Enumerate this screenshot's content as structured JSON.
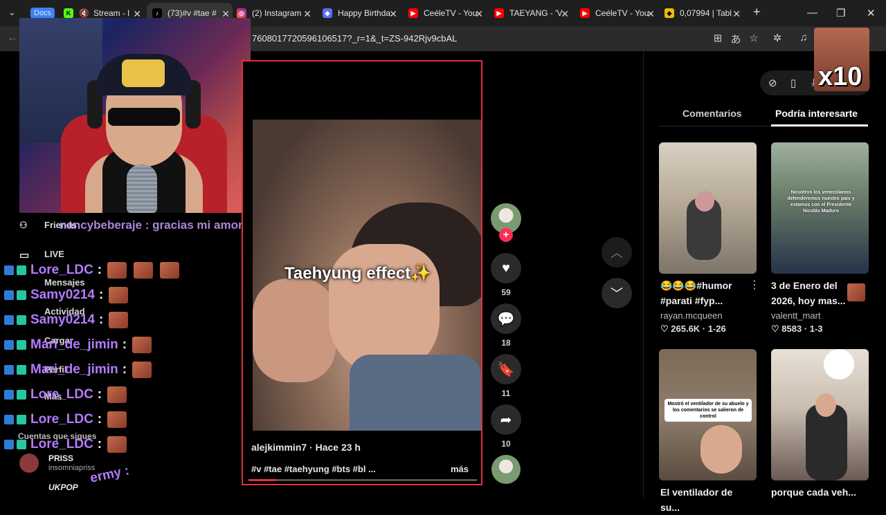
{
  "browser": {
    "tabs": [
      {
        "label": "Docs",
        "color": "#3b82f6"
      },
      {
        "label": "Stream - l",
        "color": "#53fc18"
      },
      {
        "label": "(73)#v #tae #",
        "color": "#ffffff"
      },
      {
        "label": "(2) Instagram",
        "color": "#e1306c"
      },
      {
        "label": "Happy Birthda",
        "color": "#5b6cff"
      },
      {
        "label": "CeéleTV - You",
        "color": "#ff0000"
      },
      {
        "label": "TAEYANG - 'V",
        "color": "#ff0000"
      },
      {
        "label": "CeéleTV - You",
        "color": "#ff0000"
      },
      {
        "label": "0,07994 | Tabl",
        "color": "#f0b90b"
      }
    ],
    "new_tab": "+",
    "url": "7608017720596106517?_r=1&_t=ZS-942Rjv9cbAL",
    "window_controls": {
      "minimize": "—",
      "maximize": "❐",
      "close": "✕"
    }
  },
  "sidebar_nav": {
    "friends": "Friends",
    "live": "LIVE",
    "messages": "Mensajes",
    "activity": "Actividad",
    "upload": "Cargar",
    "profile": "Perfil",
    "more": "Más",
    "following_heading": "Cuentas que sigues",
    "followed_account": {
      "name": "PRISS",
      "handle": "insomniapriss"
    },
    "followed_account_2": {
      "name": "UKPOP"
    }
  },
  "chat": {
    "top_line": "nancybeberaje : gracias mi amor",
    "messages": [
      {
        "user": "Lore_LDC",
        "emotes": 3
      },
      {
        "user": "Samy0214",
        "emotes": 1
      },
      {
        "user": "Samy0214",
        "emotes": 1
      },
      {
        "user": "Mari_de_jimin",
        "emotes": 1
      },
      {
        "user": "Mari_de_jimin",
        "emotes": 1
      },
      {
        "user": "Lore_LDC",
        "emotes": 1
      },
      {
        "user": "Lore_LDC",
        "emotes": 1
      },
      {
        "user": "Lore_LDC",
        "emotes": 1
      }
    ],
    "bottom_fragment": "ermy :"
  },
  "video": {
    "caption": "Taehyung effect✨",
    "author": "alejkimmin7 · Hace 23 h",
    "hashtags": "#v #tae #taehyung #bts #bl ...",
    "more": "más",
    "progress": 0.12
  },
  "actions": {
    "likes": "59",
    "comments": "18",
    "saves": "11",
    "shares": "10"
  },
  "right_panel": {
    "tab_comments": "Comentarios",
    "tab_suggested": "Podría interesarte",
    "cards": [
      {
        "title": "😂😂😂#humor #parati #fyp...",
        "user": "rayan.mcqueen",
        "stats": "♡ 265.6K · 1-26"
      },
      {
        "title": "3 de Enero del 2026, hoy mas...",
        "user": "valentt_mart",
        "stats": "♡ 8583 · 1-3",
        "overlay": "Nosotros los venezolanos defenderemos nuestro país y estamos con el Presidente Nicolás Maduro"
      },
      {
        "title": "El ventilador de su...",
        "overlay": "Mostró el ventilador de su abuelo y los comentarios se salieron de control"
      },
      {
        "title": "porque cada veh..."
      }
    ]
  },
  "overlay_emote": {
    "label": "x10"
  }
}
